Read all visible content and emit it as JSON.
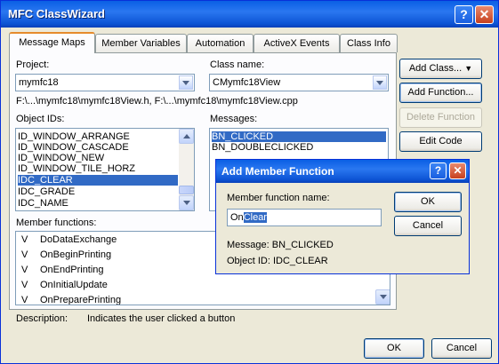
{
  "window": {
    "title": "MFC ClassWizard"
  },
  "tabs": [
    "Message Maps",
    "Member Variables",
    "Automation",
    "ActiveX Events",
    "Class Info"
  ],
  "project": {
    "label": "Project:",
    "value": "mymfc18"
  },
  "class_name": {
    "label": "Class name:",
    "value": "CMymfc18View"
  },
  "files_text": "F:\\...\\mymfc18\\mymfc18View.h, F:\\...\\mymfc18\\mymfc18View.cpp",
  "object_ids": {
    "label": "Object IDs:",
    "items": [
      "ID_WINDOW_ARRANGE",
      "ID_WINDOW_CASCADE",
      "ID_WINDOW_NEW",
      "ID_WINDOW_TILE_HORZ",
      "IDC_CLEAR",
      "IDC_GRADE",
      "IDC_NAME"
    ],
    "selected": "IDC_CLEAR"
  },
  "messages": {
    "label": "Messages:",
    "items": [
      "BN_CLICKED",
      "BN_DOUBLECLICKED"
    ],
    "selected": "BN_CLICKED"
  },
  "member_functions": {
    "label": "Member functions:",
    "items": [
      {
        "marker": "V",
        "name": "DoDataExchange"
      },
      {
        "marker": "V",
        "name": "OnBeginPrinting"
      },
      {
        "marker": "V",
        "name": "OnEndPrinting"
      },
      {
        "marker": "V",
        "name": "OnInitialUpdate"
      },
      {
        "marker": "V",
        "name": "OnPreparePrinting"
      }
    ]
  },
  "side_buttons": {
    "add_class": "Add Class...",
    "add_function": "Add Function...",
    "delete_function": "Delete Function",
    "edit_code": "Edit Code"
  },
  "description": {
    "label": "Description:",
    "text": "Indicates the user clicked a button"
  },
  "bottom_buttons": {
    "ok": "OK",
    "cancel": "Cancel"
  },
  "add_member_dialog": {
    "title": "Add Member Function",
    "field_label": "Member function name:",
    "value_prefix": "On",
    "value_selected": "Clear",
    "message_line": "Message: BN_CLICKED",
    "object_line": "Object ID: IDC_CLEAR",
    "ok": "OK",
    "cancel": "Cancel"
  }
}
